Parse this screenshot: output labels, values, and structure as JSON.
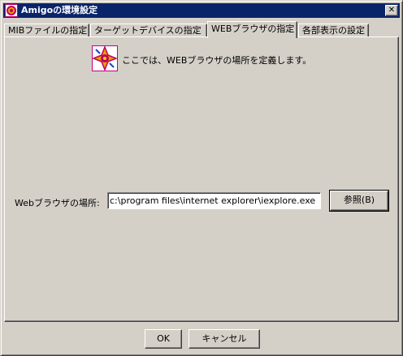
{
  "window": {
    "title": "Amigoの環境設定",
    "close_glyph": "✕"
  },
  "tabs": [
    {
      "label": "MIBファイルの指定",
      "active": false
    },
    {
      "label": "ターゲットデバイスの指定",
      "active": false
    },
    {
      "label": "WEBブラウザの指定",
      "active": true
    },
    {
      "label": "各部表示の設定",
      "active": false
    }
  ],
  "info": {
    "text": "ここでは、WEBブラウザの場所を定義します。"
  },
  "browser_path": {
    "label": "Webブラウザの場所:",
    "value": "c:\\program files\\internet explorer\\iexplore.exe",
    "browse_label": "参照(B)"
  },
  "buttons": {
    "ok_label": "OK",
    "cancel_label": "キャンセル"
  },
  "colors": {
    "titlebar": "#0a246a",
    "face": "#d4d0c8",
    "icon_accent": "#c00060"
  }
}
